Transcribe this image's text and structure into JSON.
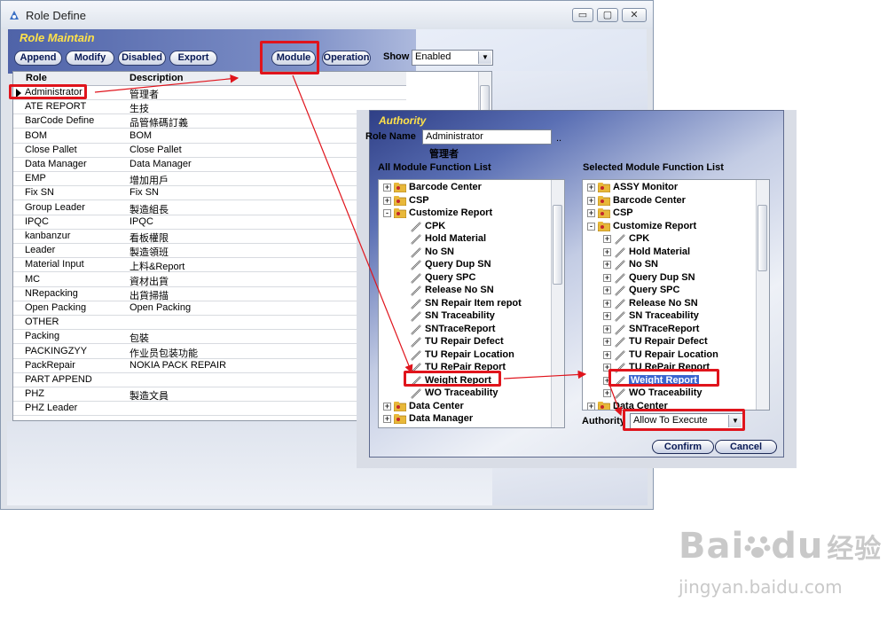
{
  "window": {
    "title": "Role Define",
    "controls": {
      "minimize": "▭",
      "maximize": "▢",
      "close": "✕"
    }
  },
  "banner": {
    "title": "Role Maintain"
  },
  "toolbar": {
    "buttons": [
      "Append",
      "Modify",
      "Disabled",
      "Export",
      "Module",
      "Operation"
    ],
    "show_label": "Show",
    "show_value": "Enabled"
  },
  "role_table": {
    "columns": [
      "Role",
      "Description"
    ],
    "rows": [
      [
        "Administrator",
        "管理者"
      ],
      [
        "ATE REPORT",
        "生技"
      ],
      [
        "BarCode Define",
        "品管條碼訂義"
      ],
      [
        "BOM",
        "BOM"
      ],
      [
        "Close Pallet",
        "Close Pallet"
      ],
      [
        "Data Manager",
        "Data Manager"
      ],
      [
        "EMP",
        "增加用戶"
      ],
      [
        "Fix SN",
        "Fix SN"
      ],
      [
        "Group Leader",
        "製造組長"
      ],
      [
        "IPQC",
        "IPQC"
      ],
      [
        "kanbanzur",
        "看板權限"
      ],
      [
        "Leader",
        "製造領班"
      ],
      [
        "Material Input",
        "上料&Report"
      ],
      [
        "MC",
        "資材出貨"
      ],
      [
        "NRepacking",
        "出貨掃描"
      ],
      [
        "Open Packing",
        "Open Packing"
      ],
      [
        "OTHER",
        ""
      ],
      [
        "Packing",
        "包裝"
      ],
      [
        "PACKINGZYY",
        "作业员包装功能"
      ],
      [
        "PackRepair",
        "NOKIA PACK REPAIR"
      ],
      [
        "PART APPEND",
        ""
      ],
      [
        "PHZ",
        "製造文員"
      ],
      [
        "PHZ Leader",
        ""
      ]
    ]
  },
  "authority": {
    "title": "Authority",
    "role_name_label": "Role Name",
    "role_name_value": "Administrator",
    "role_name_suffix": "..",
    "role_description": "管理者",
    "left_list_title": "All Module Function List",
    "right_list_title": "Selected Module Function List",
    "left_tree": [
      {
        "label": "Barcode Center",
        "kind": "folder",
        "level": 0,
        "exp": "+"
      },
      {
        "label": "CSP",
        "kind": "folder",
        "level": 0,
        "exp": "+"
      },
      {
        "label": "Customize Report",
        "kind": "folder",
        "level": 0,
        "exp": "-"
      },
      {
        "label": "CPK",
        "kind": "item",
        "level": 1
      },
      {
        "label": "Hold Material",
        "kind": "item",
        "level": 1
      },
      {
        "label": "No SN",
        "kind": "item",
        "level": 1
      },
      {
        "label": "Query Dup SN",
        "kind": "item",
        "level": 1
      },
      {
        "label": "Query SPC",
        "kind": "item",
        "level": 1
      },
      {
        "label": "Release No SN",
        "kind": "item",
        "level": 1
      },
      {
        "label": "SN Repair Item repot",
        "kind": "item",
        "level": 1
      },
      {
        "label": "SN Traceability",
        "kind": "item",
        "level": 1
      },
      {
        "label": "SNTraceReport",
        "kind": "item",
        "level": 1
      },
      {
        "label": "TU Repair Defect",
        "kind": "item",
        "level": 1
      },
      {
        "label": "TU Repair Location",
        "kind": "item",
        "level": 1
      },
      {
        "label": "TU RePair Report",
        "kind": "item",
        "level": 1
      },
      {
        "label": "Weight Report",
        "kind": "item",
        "level": 1
      },
      {
        "label": "WO Traceability",
        "kind": "item",
        "level": 1
      },
      {
        "label": "Data Center",
        "kind": "folder",
        "level": 0,
        "exp": "+"
      },
      {
        "label": "Data Manager",
        "kind": "folder",
        "level": 0,
        "exp": "+"
      }
    ],
    "right_tree": [
      {
        "label": "ASSY Monitor",
        "kind": "folder",
        "level": 0,
        "exp": "+"
      },
      {
        "label": "Barcode Center",
        "kind": "folder",
        "level": 0,
        "exp": "+"
      },
      {
        "label": "CSP",
        "kind": "folder",
        "level": 0,
        "exp": "+"
      },
      {
        "label": "Customize Report",
        "kind": "folder",
        "level": 0,
        "exp": "-"
      },
      {
        "label": "CPK",
        "kind": "item",
        "level": 1,
        "exp": "+"
      },
      {
        "label": "Hold Material",
        "kind": "item",
        "level": 1,
        "exp": "+"
      },
      {
        "label": "No SN",
        "kind": "item",
        "level": 1,
        "exp": "+"
      },
      {
        "label": "Query Dup SN",
        "kind": "item",
        "level": 1,
        "exp": "+"
      },
      {
        "label": "Query SPC",
        "kind": "item",
        "level": 1,
        "exp": "+"
      },
      {
        "label": "Release No SN",
        "kind": "item",
        "level": 1,
        "exp": "+"
      },
      {
        "label": "SN Traceability",
        "kind": "item",
        "level": 1,
        "exp": "+"
      },
      {
        "label": "SNTraceReport",
        "kind": "item",
        "level": 1,
        "exp": "+"
      },
      {
        "label": "TU Repair Defect",
        "kind": "item",
        "level": 1,
        "exp": "+"
      },
      {
        "label": "TU Repair Location",
        "kind": "item",
        "level": 1,
        "exp": "+"
      },
      {
        "label": "TU RePair Report",
        "kind": "item",
        "level": 1,
        "exp": "+"
      },
      {
        "label": "Weight Report",
        "kind": "item",
        "level": 1,
        "exp": "+",
        "selected": true
      },
      {
        "label": "WO Traceability",
        "kind": "item",
        "level": 1,
        "exp": "+"
      },
      {
        "label": "Data Center",
        "kind": "folder",
        "level": 0,
        "exp": "+"
      }
    ],
    "authority_label": "Authority",
    "authority_value": "Allow To Execute",
    "confirm_label": "Confirm",
    "cancel_label": "Cancel"
  },
  "watermark": {
    "brand": "Bai",
    "brand2": "du",
    "product": "经验",
    "url": "jingyan.baidu.com"
  },
  "colors": {
    "annotation_red": "#e0141c",
    "banner_title_yellow": "#ffe24a",
    "selection_blue": "#3a66d0"
  }
}
